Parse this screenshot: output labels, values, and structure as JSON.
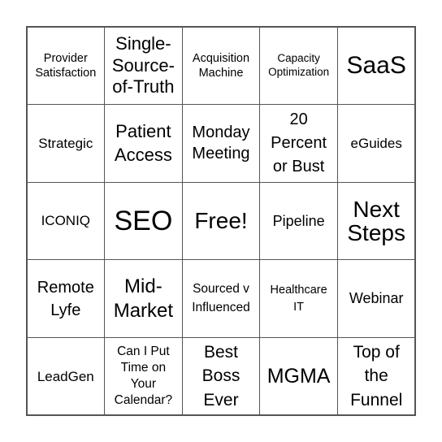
{
  "board": {
    "cells": [
      "Provider Satisfaction",
      "Single-Source-of-Truth",
      "Acquisition Machine",
      "Capacity Optimization",
      "SaaS",
      "Strategic",
      "Patient Access",
      "Monday Meeting",
      "20 Percent or Bust",
      "eGuides",
      "ICONIQ",
      "SEO",
      "Free!",
      "Pipeline",
      "Next Steps",
      "Remote Lyfe",
      "Mid-Market",
      "Sourced v Influenced",
      "Healthcare IT",
      "Webinar",
      "LeadGen",
      "Can I Put Time on Your Calendar?",
      "Best Boss Ever",
      "MGMA",
      "Top of the Funnel"
    ]
  }
}
